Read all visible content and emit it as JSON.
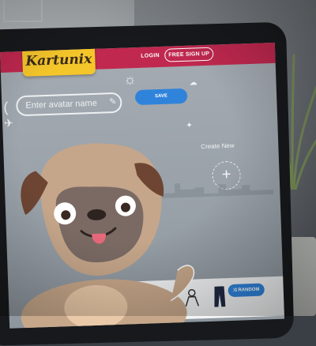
{
  "logo": {
    "text": "Kartunix"
  },
  "nav": {
    "login_label": "LOGIN",
    "signup_label": "FREE SIGN UP"
  },
  "avatar": {
    "name_placeholder": "Enter avatar name",
    "save_label": "SAVE"
  },
  "create": {
    "label": "Create New"
  },
  "toolbar": {
    "random_label": "RANDOM"
  },
  "colors": {
    "topbar": "#c0284f",
    "logo_bg": "#f5c62a",
    "accent_blue": "#2f83db"
  },
  "icons": [
    "pencil-icon",
    "paper-plane-icon",
    "sun-doodle-icon",
    "cloud-icon",
    "plus-icon",
    "shirt-icon",
    "pants-icon",
    "shuffle-icon"
  ]
}
